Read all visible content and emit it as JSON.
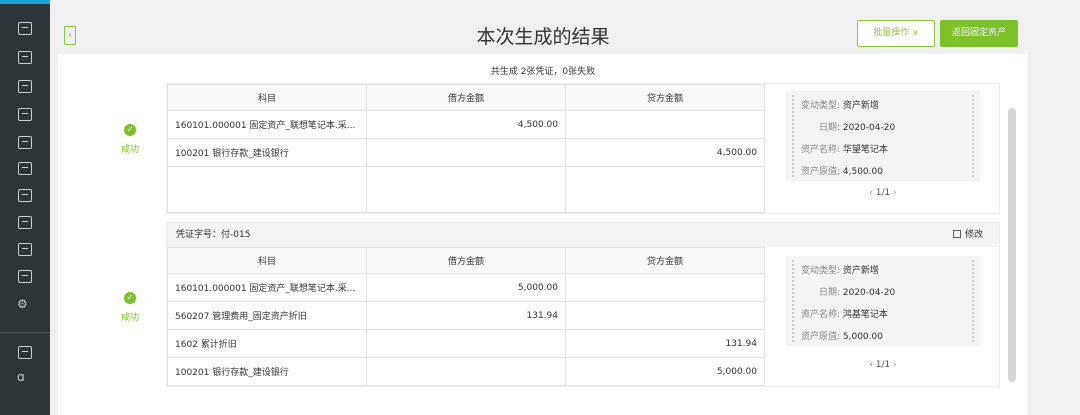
{
  "page": {
    "title": "本次生成的结果",
    "batch_label": "批量操作",
    "return_label": "返回固定资产",
    "summary": "共生成 2张凭证，0张失败"
  },
  "colors": {
    "accent": "#7cc12a",
    "sidebar": "#2e3539"
  },
  "sidebar_icons": [
    "list-icon",
    "note-icon",
    "chart-icon",
    "building-icon",
    "calendar-icon",
    "report-icon",
    "print-icon",
    "image-icon",
    "stack-icon",
    "invoice-icon",
    "settings-icon",
    "video-icon",
    "logo-icon"
  ],
  "table_headers": {
    "subject": "科目",
    "debit": "借方金额",
    "credit": "贷方金额"
  },
  "info_labels": {
    "change_type": "变动类型:",
    "date": "日期:",
    "asset_name": "资产名称:",
    "original_value": "资产原值:"
  },
  "vouchers": [
    {
      "status": "成功",
      "rows": [
        {
          "subject": "160101.000001 固定资产_联想笔记本.采...",
          "debit": "4,500.00",
          "credit": ""
        },
        {
          "subject": "100201 银行存款_建设银行",
          "debit": "",
          "credit": "4,500.00"
        }
      ],
      "info": {
        "change_type": "资产新增",
        "date": "2020-04-20",
        "asset_name": "华望笔记本",
        "original_value": "4,500.00"
      },
      "pager": "1/1"
    },
    {
      "status": "成功",
      "voucher_no": "凭证字号：付-015",
      "edit_label": "修改",
      "rows": [
        {
          "subject": "160101.000001 固定资产_联想笔记本.采...",
          "debit": "5,000.00",
          "credit": ""
        },
        {
          "subject": "560207 管理费用_固定资产折旧",
          "debit": "131.94",
          "credit": ""
        },
        {
          "subject": "1602 累计折旧",
          "debit": "",
          "credit": "131.94"
        },
        {
          "subject": "100201 银行存款_建设银行",
          "debit": "",
          "credit": "5,000.00"
        }
      ],
      "info": {
        "change_type": "资产新增",
        "date": "2020-04-20",
        "asset_name": "鸿基笔记本",
        "original_value": "5,000.00"
      },
      "pager": "1/1"
    }
  ]
}
